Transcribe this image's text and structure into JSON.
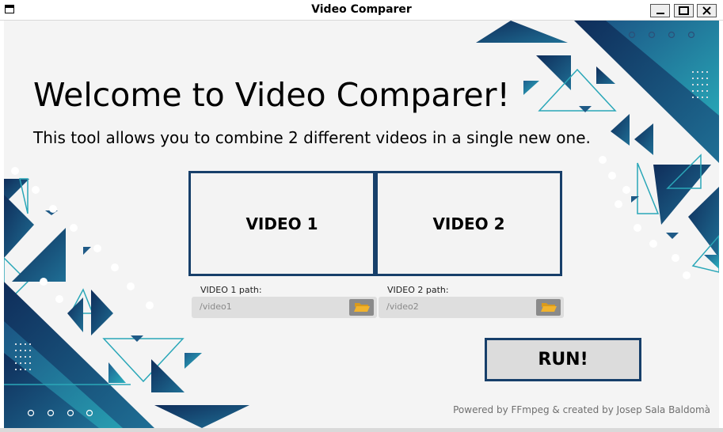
{
  "window": {
    "title": "Video Comparer",
    "icon": "app-window-icon",
    "controls": [
      "minimize-icon",
      "maximize-icon",
      "close-icon"
    ]
  },
  "main": {
    "welcome": "Welcome to Video Comparer!",
    "subtitle": "This tool allows you to combine 2 different videos in a single new one."
  },
  "videos": [
    {
      "label": "VIDEO 1",
      "path_label": "VIDEO 1 path:",
      "path_placeholder": "/video1",
      "browse_icon": "folder-open-icon"
    },
    {
      "label": "VIDEO 2",
      "path_label": "VIDEO 2 path:",
      "path_placeholder": "/video2",
      "browse_icon": "folder-open-icon"
    }
  ],
  "run_label": "RUN!",
  "footer": "Powered by FFmpeg & created by Josep Sala Baldomà",
  "colors": {
    "accent_dark": "#173f6a",
    "accent_teal": "#2aa7b8",
    "background": "#f4f4f4",
    "folder_yellow": "#f2b32c"
  }
}
